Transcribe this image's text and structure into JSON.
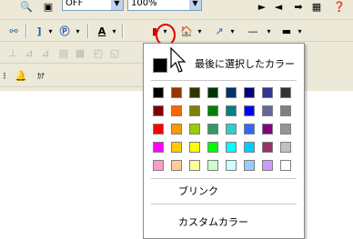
{
  "toolbar": {
    "font_size": "OFF",
    "zoom": "100%",
    "dropdown_arrow": "▾"
  },
  "icons": {
    "font_color": "A",
    "extra": "❓"
  },
  "color_popup": {
    "last_selected_label": "最後に選択したカラー",
    "last_selected_color": "#000000",
    "blink_label": "ブリンク",
    "custom_color_label": "カスタムカラー",
    "palette": [
      [
        "#000000",
        "#993300",
        "#333300",
        "#003300",
        "#003366",
        "#000080",
        "#333399",
        "#333333"
      ],
      [
        "#800000",
        "#ff6600",
        "#808000",
        "#008000",
        "#008080",
        "#0000ff",
        "#666699",
        "#808080"
      ],
      [
        "#ff0000",
        "#ff9900",
        "#99cc00",
        "#339966",
        "#33cccc",
        "#3366ff",
        "#800080",
        "#969696"
      ],
      [
        "#ff00ff",
        "#ffcc00",
        "#ffff00",
        "#00ff00",
        "#00ffff",
        "#00ccff",
        "#993366",
        "#c0c0c0"
      ],
      [
        "#ff99cc",
        "#ffcc99",
        "#ffff99",
        "#ccffcc",
        "#ccffff",
        "#99ccff",
        "#cc99ff",
        "#ffffff"
      ]
    ]
  },
  "colors": {
    "toolbar_bg": "#ece9d8",
    "highlight_circle": "#e00000"
  }
}
